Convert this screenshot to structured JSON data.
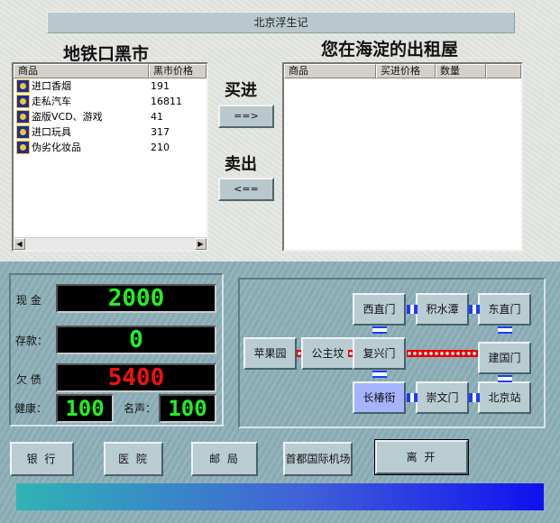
{
  "title": "北京浮生记",
  "market": {
    "title": "地铁口黑市",
    "columns": [
      "商品",
      "黑市价格"
    ],
    "items": [
      {
        "name": "进口香烟",
        "price": "191"
      },
      {
        "name": "走私汽车",
        "price": "16811"
      },
      {
        "name": "盗版VCD、游戏",
        "price": "41"
      },
      {
        "name": "进口玩具",
        "price": "317"
      },
      {
        "name": "伪劣化妆品",
        "price": "210"
      }
    ],
    "scroll_left": "◀",
    "scroll_right": "▶"
  },
  "rental": {
    "title": "您在海淀的出租屋",
    "columns": [
      "商品",
      "买进价格",
      "数量"
    ]
  },
  "trade": {
    "buy_label": "买进",
    "buy_button": "==>",
    "sell_label": "卖出",
    "sell_button": "<=="
  },
  "stats": {
    "cash_label": "现 金",
    "cash": "2000",
    "deposit_label": "存款：",
    "deposit": "0",
    "debt_label": "欠 债",
    "debt": "5400",
    "health_label": "健康：",
    "health": "100",
    "fame_label": "名声：",
    "fame": "100"
  },
  "map": {
    "stations": {
      "xizhimen": "西直门",
      "jishuitan": "积水潭",
      "dongzhimen": "东直门",
      "pingguoyuan": "苹果园",
      "gongzhufen": "公主坟",
      "fuxingmen": "复兴门",
      "jianguomen": "建国门",
      "changchunjie": "长椿街",
      "chongwenmen": "崇文门",
      "beijingzhan": "北京站"
    },
    "current": "长椿街"
  },
  "nav": {
    "bank": "银 行",
    "hospital": "医 院",
    "post": "邮 局",
    "airport": "首都国际机场",
    "leave": "离 开"
  },
  "colors": {
    "lcd_green": "#22ee22",
    "lcd_red": "#ee1111",
    "metro_line": "#1a3cff",
    "current_station": "#a6b4ff"
  }
}
